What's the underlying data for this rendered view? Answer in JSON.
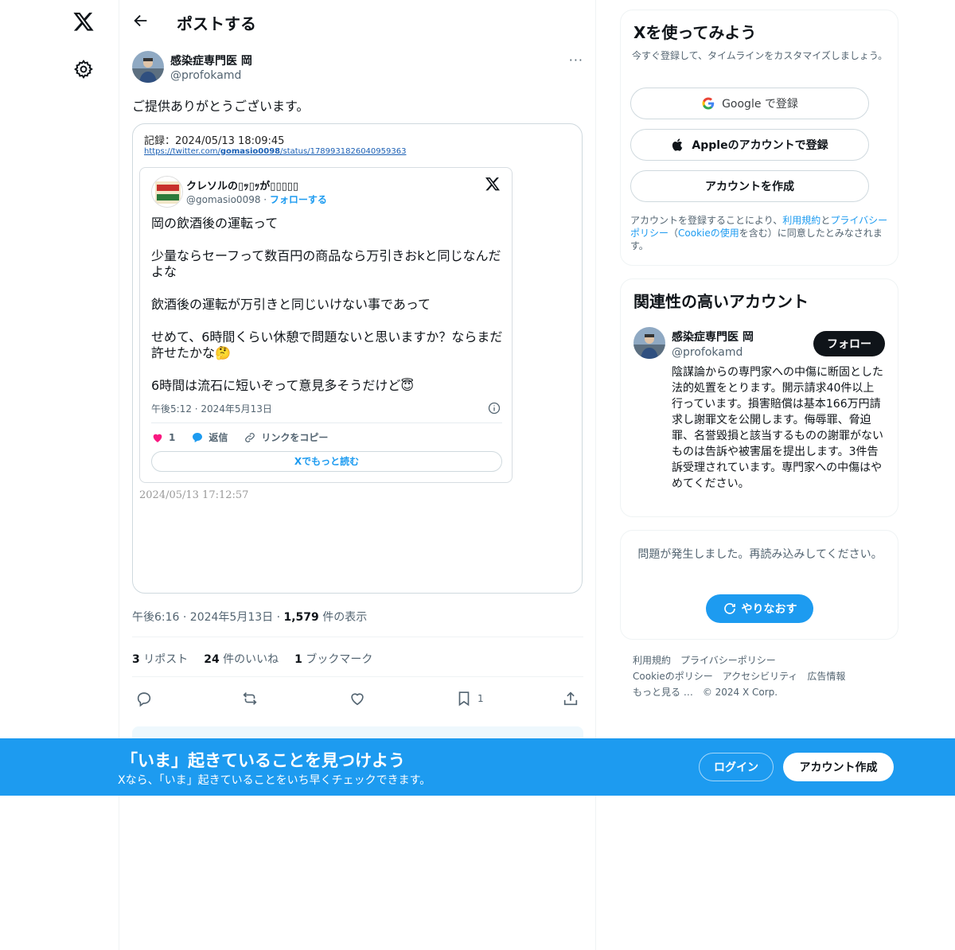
{
  "nav": {
    "logo_icon": "x-logo-icon",
    "settings_icon": "gear-icon"
  },
  "header": {
    "title": "ポストする"
  },
  "post": {
    "author_name": "感染症専門医 岡",
    "author_handle": "@profokamd",
    "more": "···",
    "text": "ご提供ありがとうございます。",
    "media": {
      "record_label": "記録：2024/05/13 18:09:45",
      "record_url_prefix": "https://twitter.com/",
      "record_url_user": "gomasio0098",
      "record_url_rest": "/status/1789931826040959363",
      "embed": {
        "name": "クレソルの▯ｯ▯ｯが▯▯▯▯▯",
        "handle": "@gomasio0098 · ",
        "follow": "フォローする",
        "paragraphs": [
          "岡の飲酒後の運転って",
          "少量ならセーフって数百円の商品なら万引きおkと同じなんだよな",
          "飲酒後の運転が万引きと同じいけない事であって",
          "せめて、6時間くらい休憩で問題ないと思いますか？ならまだ許せたかな🤔",
          "6時間は流石に短いぞって意見多そうだけど😇"
        ],
        "date": "午後5:12 · 2024年5月13日",
        "likes": "1",
        "reply": "返信",
        "copy_link": "リンクをコピー",
        "read_more": "Xでもっと読む"
      },
      "timestamp2": "2024/05/13 17:12:57"
    },
    "time": "午後6:16 · 2024年5月13日 · ",
    "views_count": "1,579",
    "views_label": " 件の表示",
    "reposts_count": "3",
    "reposts_label": " リポスト",
    "likes_count": "24",
    "likes_label": " 件のいいね",
    "bookmarks_count": "1",
    "bookmarks_label": " ブックマーク",
    "bookmark_action_count": "1"
  },
  "signup": {
    "title": "Xを使ってみよう",
    "subtitle": "今すぐ登録して、タイムラインをカスタマイズしましょう。",
    "google": "Google で登録",
    "apple": "Appleのアカウントで登録",
    "create": "アカウントを作成",
    "terms_1": "アカウントを登録することにより、",
    "terms_link1": "利用規約",
    "terms_2": "と",
    "terms_link2": "プライバシーポリシー",
    "terms_3": "（",
    "terms_link3": "Cookieの使用",
    "terms_4": "を含む）に同意したとみなされます。"
  },
  "related": {
    "title": "関連性の高いアカウント",
    "name": "感染症専門医 岡",
    "handle": "@profokamd",
    "follow": "フォロー",
    "bio": "陰謀論からの専門家への中傷に断固とした法的処置をとります。開示請求40件以上行っています。損害賠償は基本166万円請求し謝罪文を公開します。侮辱罪、脅迫罪、名誉毀損と該当するものの謝罪がないものは告訴や被害届を提出します。3件告訴受理されています。専門家への中傷はやめてください。"
  },
  "error": {
    "message": "問題が発生しました。再読み込みしてください。",
    "retry": "やりなおす"
  },
  "footer": {
    "links": [
      "利用規約",
      "プライバシーポリシー",
      "Cookieのポリシー",
      "アクセシビリティ",
      "広告情報",
      "もっと見る …",
      "© 2024 X Corp."
    ]
  },
  "banner": {
    "title": "「いま」起きていることを見つけよう",
    "subtitle": "Xなら、「いま」起きていることをいち早くチェックできます。",
    "login": "ログイン",
    "create": "アカウント作成"
  },
  "colors": {
    "accent": "#1d9bf0",
    "text": "#0f1419",
    "muted": "#536471",
    "border": "#eff3f4"
  }
}
